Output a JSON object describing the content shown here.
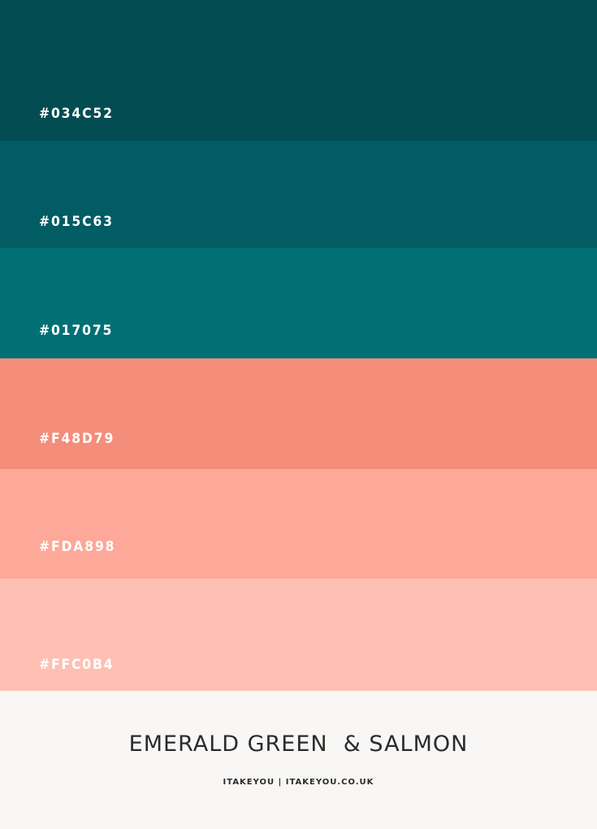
{
  "swatches": [
    {
      "hex_label": "#034C52",
      "color": "#034C52"
    },
    {
      "hex_label": "#015C63",
      "color": "#015C63"
    },
    {
      "hex_label": "#017075",
      "color": "#017075"
    },
    {
      "hex_label": "#F48D79",
      "color": "#F48D79"
    },
    {
      "hex_label": "#FDA898",
      "color": "#FDA898"
    },
    {
      "hex_label": "#FFC0B4",
      "color": "#FFC0B4"
    }
  ],
  "footer": {
    "title": "EMERALD GREEN  & SALMON",
    "credit": "ITAKEYOU | ITAKEYOU.CO.UK",
    "background": "#F8F7F6"
  }
}
